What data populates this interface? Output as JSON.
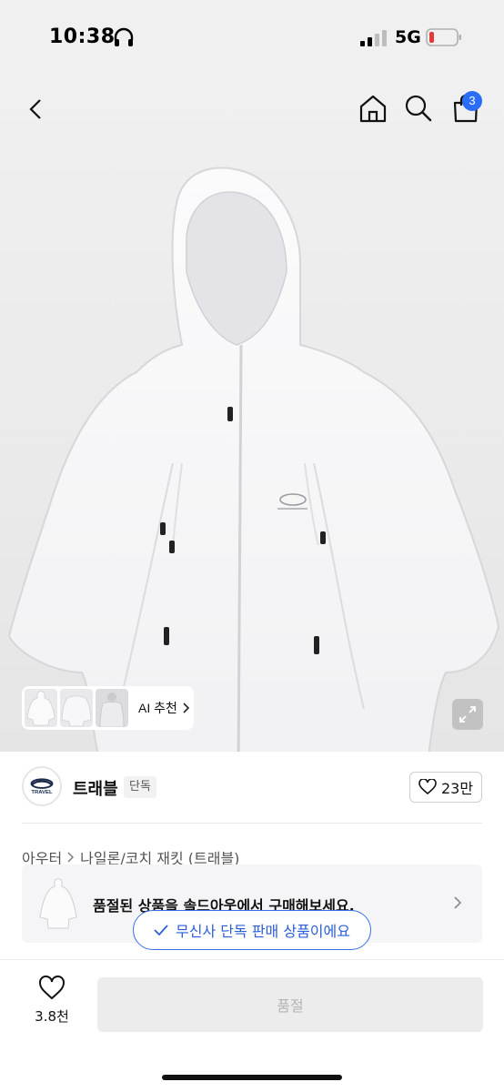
{
  "status_bar": {
    "time": "10:38",
    "network": "5G",
    "headphone_icon": "headphones-icon",
    "signal_icon": "cellular-signal-icon",
    "battery_icon": "battery-low-icon",
    "battery_color": "#e23a3a"
  },
  "nav": {
    "back_icon": "chevron-left-icon",
    "home_icon": "home-icon",
    "search_icon": "search-icon",
    "cart_icon": "shopping-bag-icon",
    "cart_count": "3",
    "badge_color": "#2b6ef5"
  },
  "gallery": {
    "ai_recommend_label": "AI 추천",
    "expand_icon": "expand-icon"
  },
  "brand": {
    "logo_text": "TRAVEL",
    "name": "트래블",
    "exclusive_tag": "단독",
    "like_count": "23만"
  },
  "breadcrumb": {
    "items": [
      "아우터",
      "나일론/코치 재킷 (트래블)"
    ]
  },
  "soldout_banner": {
    "text": "품절된 상품을 솔드아웃에서 구매해보세요."
  },
  "exclusive_pill": {
    "text": "무신사 단독 판매 상품이에요",
    "accent_color": "#2b5fd9"
  },
  "bottom_bar": {
    "wish_count": "3.8천",
    "buy_button_label": "품절"
  }
}
